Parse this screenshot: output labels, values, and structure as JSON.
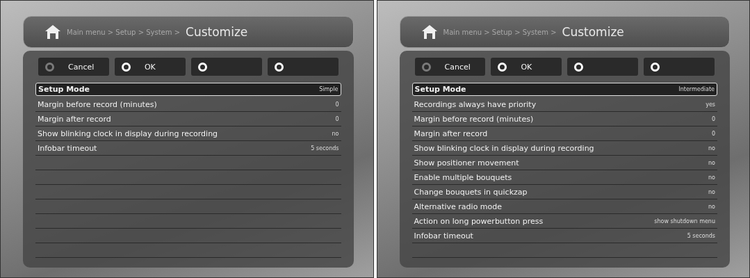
{
  "screens": [
    {
      "breadcrumb": "Main menu > Setup > System >",
      "title": "Customize",
      "buttons": [
        {
          "label": "Cancel",
          "color": "#7a7a7a"
        },
        {
          "label": "OK",
          "color": "#ffffff"
        },
        {
          "color": "#ffffff"
        },
        {
          "color": "#ffffff"
        }
      ],
      "rows": [
        {
          "label": "Setup Mode",
          "value": "Simple",
          "selected": true
        },
        {
          "label": "Margin before record (minutes)",
          "value": "0",
          "selected": false
        },
        {
          "label": "Margin after record",
          "value": "0",
          "selected": false
        },
        {
          "label": "Show blinking clock in display during recording",
          "value": "no",
          "selected": false
        },
        {
          "label": "Infobar timeout",
          "value": "5 seconds",
          "selected": false
        }
      ]
    },
    {
      "breadcrumb": "Main menu > Setup > System >",
      "title": "Customize",
      "buttons": [
        {
          "label": "Cancel",
          "color": "#7a7a7a"
        },
        {
          "label": "OK",
          "color": "#ffffff"
        },
        {
          "color": "#ffffff"
        },
        {
          "color": "#ffffff"
        }
      ],
      "rows": [
        {
          "label": "Setup Mode",
          "value": "Intermediate",
          "selected": true
        },
        {
          "label": "Recordings always have priority",
          "value": "yes",
          "selected": false
        },
        {
          "label": "Margin before record (minutes)",
          "value": "0",
          "selected": false
        },
        {
          "label": "Margin after record",
          "value": "0",
          "selected": false
        },
        {
          "label": "Show blinking clock in display during recording",
          "value": "no",
          "selected": false
        },
        {
          "label": "Show positioner movement",
          "value": "no",
          "selected": false
        },
        {
          "label": "Enable multiple bouquets",
          "value": "no",
          "selected": false
        },
        {
          "label": "Change bouquets in quickzap",
          "value": "no",
          "selected": false
        },
        {
          "label": "Alternative radio mode",
          "value": "no",
          "selected": false
        },
        {
          "label": "Action on long powerbutton press",
          "value": "show shutdown menu",
          "selected": false
        },
        {
          "label": "Infobar timeout",
          "value": "5 seconds",
          "selected": false
        }
      ]
    }
  ]
}
